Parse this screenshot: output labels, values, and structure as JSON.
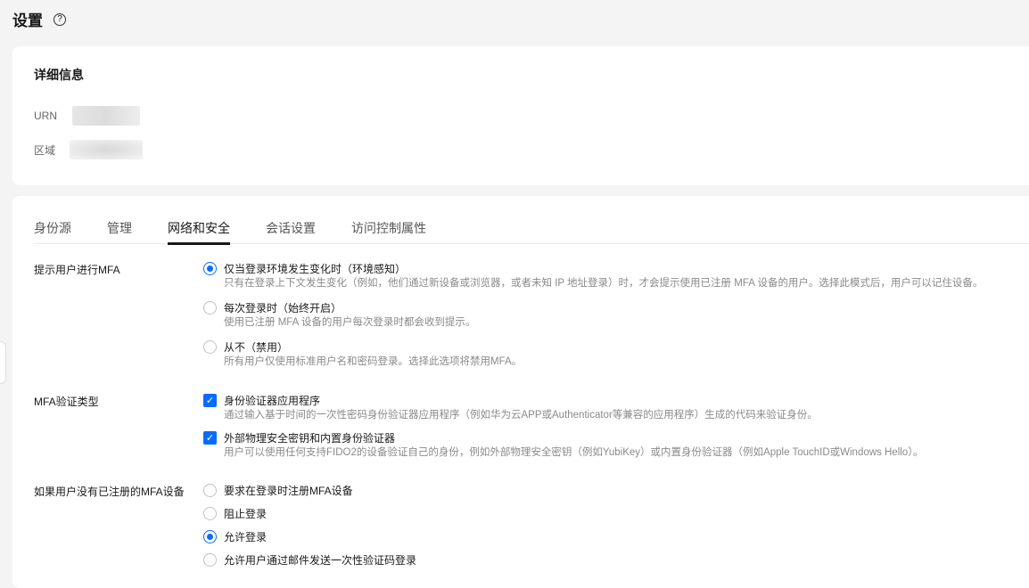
{
  "page": {
    "title": "设置"
  },
  "details": {
    "heading": "详细信息",
    "urn_label": "URN",
    "region_label": "区域"
  },
  "tabs": [
    "身份源",
    "管理",
    "网络和安全",
    "会话设置",
    "访问控制属性"
  ],
  "mfa_prompt": {
    "label": "提示用户进行MFA",
    "options": [
      {
        "title": "仅当登录环境发生变化时（环境感知）",
        "desc": "只有在登录上下文发生变化（例如，他们通过新设备或浏览器，或者未知 IP 地址登录）时，才会提示使用已注册 MFA 设备的用户。选择此模式后，用户可以记住设备。",
        "selected": true
      },
      {
        "title": "每次登录时（始终开启）",
        "desc": "使用已注册 MFA 设备的用户每次登录时都会收到提示。",
        "selected": false
      },
      {
        "title": "从不（禁用）",
        "desc": "所有用户仅使用标准用户名和密码登录。选择此选项将禁用MFA。",
        "selected": false
      }
    ]
  },
  "mfa_type": {
    "label": "MFA验证类型",
    "options": [
      {
        "title": "身份验证器应用程序",
        "desc": "通过输入基于时间的一次性密码身份验证器应用程序（例如华为云APP或Authenticator等兼容的应用程序）生成的代码来验证身份。",
        "checked": true
      },
      {
        "title": "外部物理安全密钥和内置身份验证器",
        "desc": "用户可以使用任何支持FIDO2的设备验证自己的身份，例如外部物理安全密钥（例如YubiKey）或内置身份验证器（例如Apple TouchID或Windows Hello）。",
        "checked": true
      }
    ]
  },
  "no_mfa": {
    "label": "如果用户没有已注册的MFA设备",
    "options": [
      {
        "title": "要求在登录时注册MFA设备",
        "selected": false
      },
      {
        "title": "阻止登录",
        "selected": false
      },
      {
        "title": "允许登录",
        "selected": true
      },
      {
        "title": "允许用户通过邮件发送一次性验证码登录",
        "selected": false
      }
    ]
  }
}
